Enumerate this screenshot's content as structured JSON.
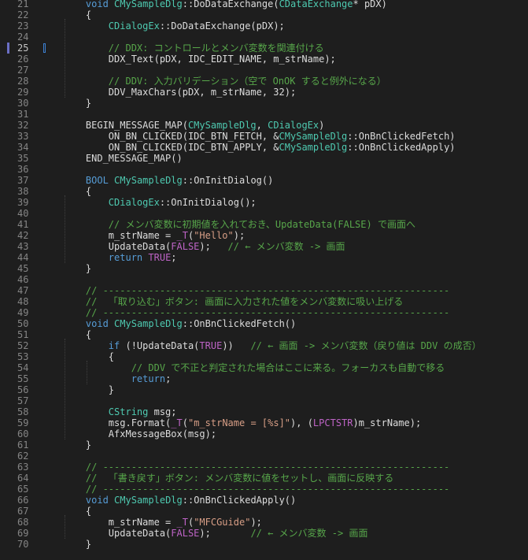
{
  "editor": {
    "current_line": "25",
    "lines": [
      {
        "n": "21",
        "t": [
          [
            "    ",
            ""
          ],
          [
            "void",
            "kw"
          ],
          [
            " ",
            ""
          ],
          [
            "CMySampleDlg",
            "cls"
          ],
          [
            "::DoDataExchange(",
            ""
          ],
          [
            "CDataExchange",
            "cls"
          ],
          [
            "* pDX)",
            ""
          ]
        ]
      },
      {
        "n": "22",
        "t": [
          [
            "    {",
            ""
          ]
        ]
      },
      {
        "n": "23",
        "t": [
          [
            "        ",
            ""
          ],
          [
            "CDialogEx",
            "cls"
          ],
          [
            "::DoDataExchange(pDX);",
            ""
          ]
        ]
      },
      {
        "n": "24",
        "t": []
      },
      {
        "n": "25",
        "t": [
          [
            "        ",
            ""
          ],
          [
            "// DDX: コントロールとメンバ変数を関連付ける",
            "cm"
          ]
        ]
      },
      {
        "n": "26",
        "t": [
          [
            "        DDX_Text(pDX, IDC_EDIT_NAME, m_strName);",
            ""
          ]
        ]
      },
      {
        "n": "27",
        "t": []
      },
      {
        "n": "28",
        "t": [
          [
            "        ",
            ""
          ],
          [
            "// DDV: 入力バリデーション（空で OnOK すると例外になる）",
            "cm"
          ]
        ]
      },
      {
        "n": "29",
        "t": [
          [
            "        DDV_MaxChars(pDX, m_strName, 32);",
            ""
          ]
        ]
      },
      {
        "n": "30",
        "t": [
          [
            "    }",
            ""
          ]
        ]
      },
      {
        "n": "31",
        "t": []
      },
      {
        "n": "32",
        "t": [
          [
            "    BEGIN_MESSAGE_MAP(",
            ""
          ],
          [
            "CMySampleDlg",
            "cls"
          ],
          [
            ", ",
            ""
          ],
          [
            "CDialogEx",
            "cls"
          ],
          [
            ")",
            ""
          ]
        ]
      },
      {
        "n": "33",
        "t": [
          [
            "        ON_BN_CLICKED(IDC_BTN_FETCH, &",
            ""
          ],
          [
            "CMySampleDlg",
            "cls"
          ],
          [
            "::OnBnClickedFetch)",
            ""
          ]
        ]
      },
      {
        "n": "34",
        "t": [
          [
            "        ON_BN_CLICKED(IDC_BTN_APPLY, &",
            ""
          ],
          [
            "CMySampleDlg",
            "cls"
          ],
          [
            "::OnBnClickedApply)",
            ""
          ]
        ]
      },
      {
        "n": "35",
        "t": [
          [
            "    END_MESSAGE_MAP()",
            ""
          ]
        ]
      },
      {
        "n": "36",
        "t": []
      },
      {
        "n": "37",
        "t": [
          [
            "    ",
            ""
          ],
          [
            "BOOL",
            "kw"
          ],
          [
            " ",
            ""
          ],
          [
            "CMySampleDlg",
            "cls"
          ],
          [
            "::OnInitDialog()",
            ""
          ]
        ]
      },
      {
        "n": "38",
        "t": [
          [
            "    {",
            ""
          ]
        ]
      },
      {
        "n": "39",
        "t": [
          [
            "        ",
            ""
          ],
          [
            "CDialogEx",
            "cls"
          ],
          [
            "::OnInitDialog();",
            ""
          ]
        ]
      },
      {
        "n": "40",
        "t": []
      },
      {
        "n": "41",
        "t": [
          [
            "        ",
            ""
          ],
          [
            "// メンバ変数に初期値を入れておき、UpdateData(FALSE) で画面へ",
            "cm"
          ]
        ]
      },
      {
        "n": "42",
        "t": [
          [
            "        m_strName = ",
            ""
          ],
          [
            "_T",
            "mac"
          ],
          [
            "(",
            ""
          ],
          [
            "\"Hello\"",
            "str"
          ],
          [
            ");",
            ""
          ]
        ]
      },
      {
        "n": "43",
        "t": [
          [
            "        UpdateData(",
            ""
          ],
          [
            "FALSE",
            "mac"
          ],
          [
            ");   ",
            ""
          ],
          [
            "// ← メンバ変数 -> 画面",
            "cm"
          ]
        ]
      },
      {
        "n": "44",
        "t": [
          [
            "        ",
            ""
          ],
          [
            "return",
            "kw"
          ],
          [
            " ",
            ""
          ],
          [
            "TRUE",
            "mac"
          ],
          [
            ";",
            ""
          ]
        ]
      },
      {
        "n": "45",
        "t": [
          [
            "    }",
            ""
          ]
        ]
      },
      {
        "n": "46",
        "t": []
      },
      {
        "n": "47",
        "t": [
          [
            "    ",
            ""
          ],
          [
            "// -------------------------------------------------------------",
            "cm"
          ]
        ]
      },
      {
        "n": "48",
        "t": [
          [
            "    ",
            ""
          ],
          [
            "//  「取り込む」ボタン: 画面に入力された値をメンバ変数に吸い上げる",
            "cm"
          ]
        ]
      },
      {
        "n": "49",
        "t": [
          [
            "    ",
            ""
          ],
          [
            "// -------------------------------------------------------------",
            "cm"
          ]
        ]
      },
      {
        "n": "50",
        "t": [
          [
            "    ",
            ""
          ],
          [
            "void",
            "kw"
          ],
          [
            " ",
            ""
          ],
          [
            "CMySampleDlg",
            "cls"
          ],
          [
            "::OnBnClickedFetch()",
            ""
          ]
        ]
      },
      {
        "n": "51",
        "t": [
          [
            "    {",
            ""
          ]
        ]
      },
      {
        "n": "52",
        "t": [
          [
            "        ",
            ""
          ],
          [
            "if",
            "kw"
          ],
          [
            " (!UpdateData(",
            ""
          ],
          [
            "TRUE",
            "mac"
          ],
          [
            "))   ",
            ""
          ],
          [
            "// ← 画面 -> メンバ変数（戻り値は DDV の成否）",
            "cm"
          ]
        ]
      },
      {
        "n": "53",
        "t": [
          [
            "        {",
            ""
          ]
        ]
      },
      {
        "n": "54",
        "t": [
          [
            "            ",
            ""
          ],
          [
            "// DDV で不正と判定された場合はここに来る。フォーカスも自動で移る",
            "cm"
          ]
        ]
      },
      {
        "n": "55",
        "t": [
          [
            "            ",
            ""
          ],
          [
            "return",
            "kw"
          ],
          [
            ";",
            ""
          ]
        ]
      },
      {
        "n": "56",
        "t": [
          [
            "        }",
            ""
          ]
        ]
      },
      {
        "n": "57",
        "t": []
      },
      {
        "n": "58",
        "t": [
          [
            "        ",
            ""
          ],
          [
            "CString",
            "cls"
          ],
          [
            " msg;",
            ""
          ]
        ]
      },
      {
        "n": "59",
        "t": [
          [
            "        msg.Format(",
            ""
          ],
          [
            "_T",
            "mac"
          ],
          [
            "(",
            ""
          ],
          [
            "\"m_strName = [%s]\"",
            "str"
          ],
          [
            "), (",
            ""
          ],
          [
            "LPCTSTR",
            "mac"
          ],
          [
            ")m_strName);",
            ""
          ]
        ]
      },
      {
        "n": "60",
        "t": [
          [
            "        AfxMessageBox(msg);",
            ""
          ]
        ]
      },
      {
        "n": "61",
        "t": [
          [
            "    }",
            ""
          ]
        ]
      },
      {
        "n": "62",
        "t": []
      },
      {
        "n": "63",
        "t": [
          [
            "    ",
            ""
          ],
          [
            "// -------------------------------------------------------------",
            "cm"
          ]
        ]
      },
      {
        "n": "64",
        "t": [
          [
            "    ",
            ""
          ],
          [
            "//  「書き戻す」ボタン: メンバ変数に値をセットし、画面に反映する",
            "cm"
          ]
        ]
      },
      {
        "n": "65",
        "t": [
          [
            "    ",
            ""
          ],
          [
            "// -------------------------------------------------------------",
            "cm"
          ]
        ]
      },
      {
        "n": "66",
        "t": [
          [
            "    ",
            ""
          ],
          [
            "void",
            "kw"
          ],
          [
            " ",
            ""
          ],
          [
            "CMySampleDlg",
            "cls"
          ],
          [
            "::OnBnClickedApply()",
            ""
          ]
        ]
      },
      {
        "n": "67",
        "t": [
          [
            "    {",
            ""
          ]
        ]
      },
      {
        "n": "68",
        "t": [
          [
            "        m_strName = ",
            ""
          ],
          [
            "_T",
            "mac"
          ],
          [
            "(",
            ""
          ],
          [
            "\"MFCGuide\"",
            "str"
          ],
          [
            ");",
            ""
          ]
        ]
      },
      {
        "n": "69",
        "t": [
          [
            "        UpdateData(",
            ""
          ],
          [
            "FALSE",
            "mac"
          ],
          [
            ");       ",
            ""
          ],
          [
            "// ← メンバ変数 -> 画面",
            "cm"
          ]
        ]
      },
      {
        "n": "70",
        "t": [
          [
            "    }",
            ""
          ]
        ]
      }
    ]
  },
  "colors": {
    "background": "#1e1e1e",
    "line_number": "#858585",
    "keyword": "#569cd6",
    "class": "#4ec9b0",
    "macro": "#bd63c5",
    "comment": "#57a64a",
    "string": "#d69d85",
    "text": "#dcdcdc",
    "margin_indicator": "#6b6fc5"
  }
}
